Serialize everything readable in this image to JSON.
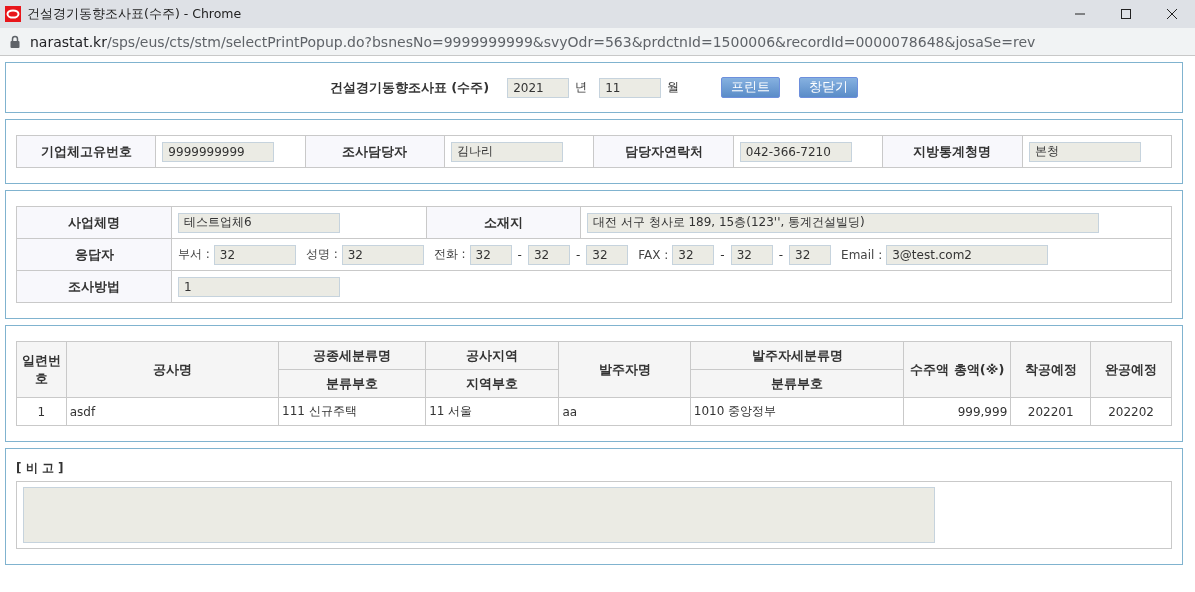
{
  "window": {
    "title": "건설경기동향조사표(수주) - Chrome",
    "url_host": "narastat.kr",
    "url_path": "/sps/eus/cts/stm/selectPrintPopup.do?bsnesNo=9999999999&svyOdr=563&prdctnId=1500006&recordId=0000078648&josaSe=rev"
  },
  "header": {
    "title": "건설경기동향조사표 (수주)",
    "year": "2021",
    "year_unit": "년",
    "month": "11",
    "month_unit": "월",
    "buttons": [
      "프린트",
      "창닫기"
    ]
  },
  "company": [
    {
      "label": "기업체고유번호",
      "value": "9999999999"
    },
    {
      "label": "조사담당자",
      "value": "김나리"
    },
    {
      "label": "담당자연락처",
      "value": "042-366-7210"
    },
    {
      "label": "지방통계청명",
      "value": "본청"
    }
  ],
  "business": {
    "name_label": "사업체명",
    "name": "테스트업체6",
    "location_label": "소재지",
    "location": "대전 서구 청사로 189, 15층(123'', 통계건설빌딩)",
    "respondent_label": "응답자",
    "respondent": [
      {
        "label": "부서 :",
        "values": [
          "32"
        ]
      },
      {
        "label": "성명 :",
        "values": [
          "32"
        ]
      },
      {
        "label": "전화 :",
        "values": [
          "32",
          "32",
          "32"
        ],
        "separator": "-"
      },
      {
        "label": "FAX :",
        "values": [
          "32",
          "32",
          "32"
        ],
        "separator": "-"
      },
      {
        "label": "Email :",
        "values": [
          "3@test.com2"
        ],
        "wide": true
      }
    ],
    "method_label": "조사방법",
    "method": "1"
  },
  "orders": {
    "columns": [
      {
        "label": "일련번호"
      },
      {
        "label": "공사명"
      },
      {
        "label": "공종세분류명",
        "sub": "분류부호"
      },
      {
        "label": "공사지역",
        "sub": "지역부호"
      },
      {
        "label": "발주자명"
      },
      {
        "label": "발주자세분류명",
        "sub": "분류부호"
      },
      {
        "label": "수주액 총액(※)"
      },
      {
        "label": "착공예정"
      },
      {
        "label": "완공예정"
      }
    ],
    "rows": [
      [
        "1",
        "asdf",
        "111 신규주택",
        "11 서울",
        "aa",
        "1010 중앙정부",
        "999,999",
        "202201",
        "202202"
      ]
    ]
  },
  "remarks": {
    "title": "[ 비 고 ]"
  }
}
